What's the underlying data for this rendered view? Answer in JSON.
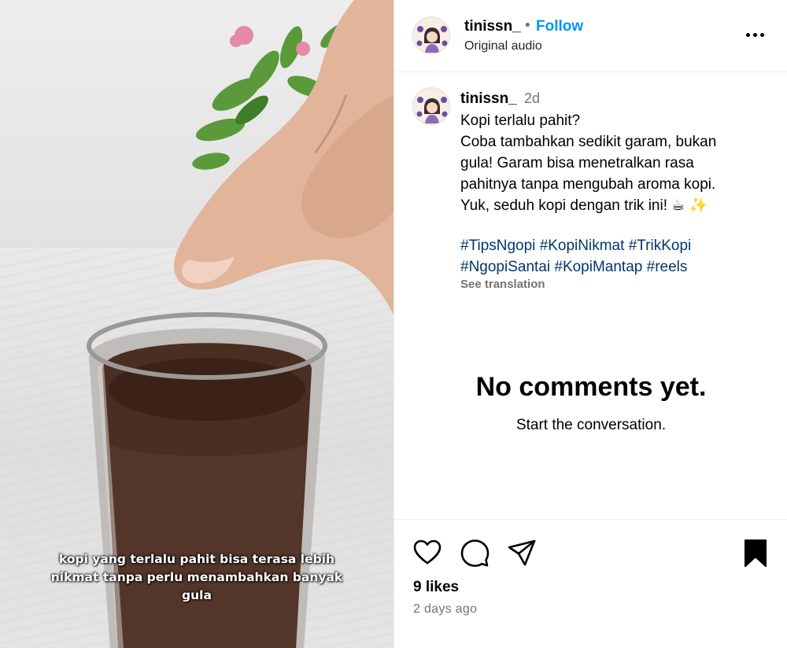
{
  "post": {
    "media": {
      "video_caption": "kopi yang terlalu pahit bisa terasa lebih nikmat tanpa perlu menambahkan banyak gula",
      "caption_lines": [
        "kopi yang terlalu pahit bisa terasa lebih",
        "nikmat tanpa perlu menambahkan banyak",
        "gula"
      ]
    },
    "header": {
      "username": "tinissn_",
      "separator": "•",
      "follow_label": "Follow",
      "audio_label": "Original audio",
      "more_icon": "more-horizontal-icon"
    },
    "caption": {
      "username": "tinissn_",
      "time": "2d",
      "lines": [
        "Kopi terlalu pahit?",
        "Coba tambahkan sedikit garam, bukan",
        "gula! Garam bisa menetralkan rasa",
        "pahitnya tanpa mengubah aroma kopi.",
        "Yuk, seduh kopi dengan trik ini! ☕ ✨"
      ],
      "hashtags": [
        "#TipsNgopi",
        "#KopiNikmat",
        "#TrikKopi",
        "#NgopiSantai",
        "#KopiMantap",
        "#reels"
      ],
      "see_translation": "See translation"
    },
    "empty_state": {
      "title": "No comments yet.",
      "subtitle": "Start the conversation."
    },
    "actions": {
      "like_icon": "heart-icon",
      "comment_icon": "comment-icon",
      "share_icon": "send-icon",
      "save_icon": "bookmark-icon",
      "likes": "9 likes",
      "posted_ago": "2 days ago"
    },
    "colors": {
      "accent": "#0095f6",
      "hashtag": "#00376b",
      "muted": "#737373",
      "divider": "#efefef"
    }
  }
}
